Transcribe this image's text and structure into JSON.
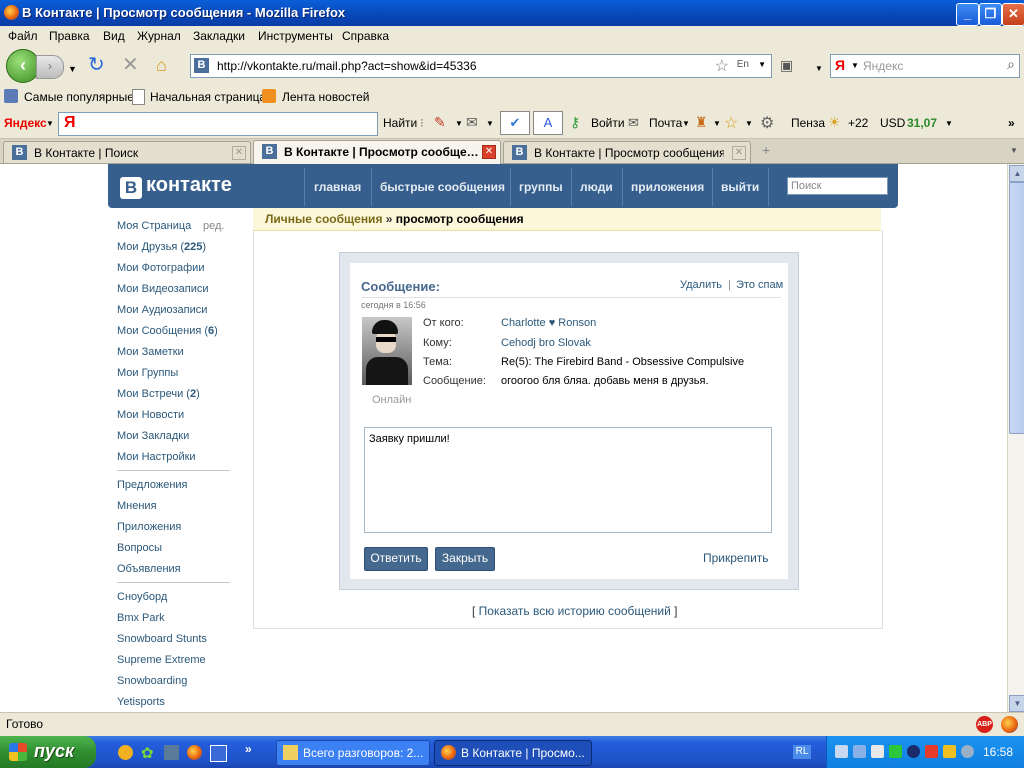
{
  "window": {
    "title": "В Контакте | Просмотр сообщения - Mozilla Firefox",
    "minimize": "_",
    "maximize": "❐",
    "close": "✕"
  },
  "menu": [
    "Файл",
    "Правка",
    "Вид",
    "Журнал",
    "Закладки",
    "Инструменты",
    "Справка"
  ],
  "nav": {
    "url": "http://vkontakte.ru/mail.php?act=show&id=45336",
    "url_favicon": "B",
    "search_placeholder": "Яндекс",
    "search_engine": "Я"
  },
  "bookmarks": [
    "Самые популярные",
    "Начальная страница",
    "Лента новостей"
  ],
  "yandex_bar": {
    "logo": "Яндекс",
    "find": "Найти",
    "login": "Войти",
    "mail": "Почта",
    "city": "Пенза",
    "temperature": "+22",
    "currency": "USD",
    "rate": "31,07"
  },
  "tabs": [
    {
      "title": "В Контакте | Поиск",
      "favicon": "B",
      "active": false
    },
    {
      "title": "В Контакте | Просмотр сообще…",
      "favicon": "B",
      "active": true
    },
    {
      "title": "В Контакте | Просмотр сообщения",
      "favicon": "B",
      "active": false
    }
  ],
  "vk": {
    "logo_b": "B",
    "logo_text": "контакте",
    "nav": [
      "главная",
      "быстрые сообщения",
      "группы",
      "люди",
      "приложения",
      "выйти"
    ],
    "search_placeholder": "Поиск"
  },
  "left_menu": {
    "my_page": "Моя Страница",
    "edit": "ред.",
    "friends": "Мои Друзья (",
    "friends_count": "225",
    "friends_close": ")",
    "photos": "Мои Фотографии",
    "videos": "Мои Видеозаписи",
    "audio": "Мои Аудиозаписи",
    "messages": "Мои Сообщения (",
    "messages_count": "6",
    "messages_close": ")",
    "notes": "Мои Заметки",
    "groups": "Мои Группы",
    "events": "Мои Встречи (",
    "events_count": "2",
    "events_close": ")",
    "news": "Мои Новости",
    "bookmarks": "Мои Закладки",
    "settings": "Мои Настройки",
    "section2": [
      "Предложения",
      "Мнения",
      "Приложения",
      "Вопросы",
      "Объявления"
    ],
    "section3": [
      "Сноуборд",
      "Bmx Park",
      "Snowboard Stunts",
      "Supreme Extreme",
      "Snowboarding",
      "Yetisports"
    ]
  },
  "breadcrumb": {
    "parent": "Личные сообщения",
    "sep": " » ",
    "current": "просмотр сообщения"
  },
  "message": {
    "header": "Сообщение:",
    "delete": "Удалить",
    "divider": "|",
    "spam": "Это спам",
    "date": "сегодня в 16:56",
    "online": "Онлайн",
    "labels": {
      "from": "От кого:",
      "to": "Кому:",
      "subject": "Тема:",
      "message": "Сообщение:"
    },
    "from": "Charlotte ♥ Ronson",
    "to": "Cehodj bro Slovak",
    "subject": "Re(5): The Firebird Band - Obsessive Compulsive",
    "body": "огоогоо бля бляа. добавь меня в друзья.",
    "reply_text": "Заявку пришли!",
    "reply_button": "Ответить",
    "close_button": "Закрыть",
    "attach": "Прикрепить",
    "history_open": "[ ",
    "history_link": "Показать всю историю сообщений",
    "history_close": " ]"
  },
  "status": "Готово",
  "taskbar": {
    "start": "пуск",
    "buttons": [
      "Всего разговоров: 2...",
      "В Контакте | Просмо..."
    ],
    "lang": "RL",
    "clock": "16:58"
  },
  "colors": {
    "vk_blue": "#365f8e",
    "link": "#2b587a",
    "button": "#45688e",
    "xp_blue": "#245edc"
  }
}
